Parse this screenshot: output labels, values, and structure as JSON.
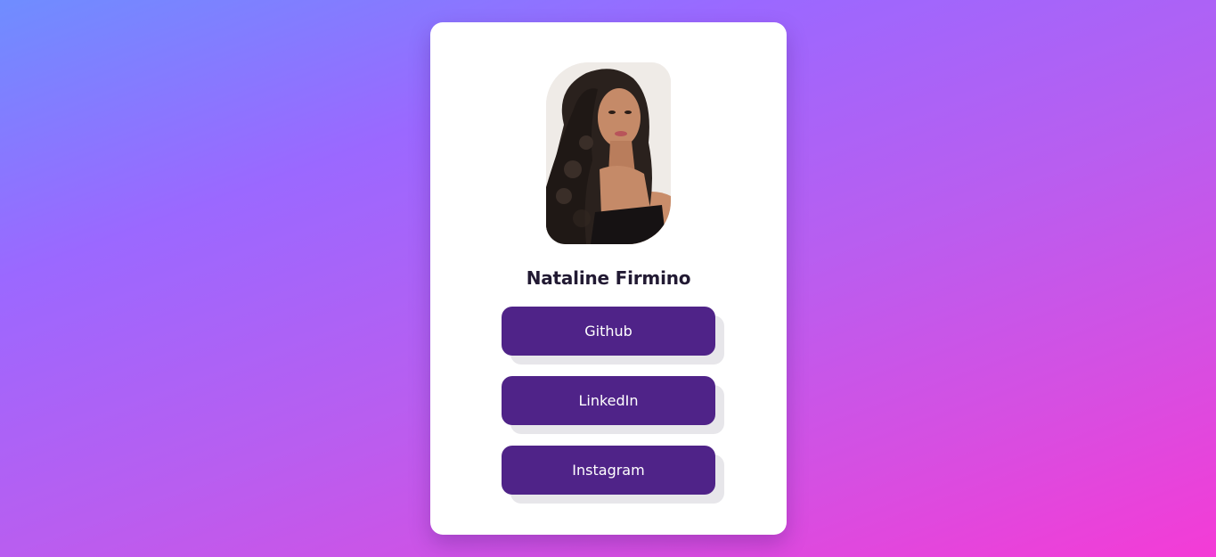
{
  "profile": {
    "name": "Nataline Firmino",
    "avatar_icon": "profile-photo"
  },
  "links": [
    {
      "label": "Github"
    },
    {
      "label": "LinkedIn"
    },
    {
      "label": "Instagram"
    }
  ],
  "colors": {
    "button": "#4f2388",
    "button_shadow": "#e7e6ea",
    "card": "#ffffff",
    "name_text": "#221a33",
    "gradient_start": "#6f8dff",
    "gradient_end": "#f43bd6"
  }
}
